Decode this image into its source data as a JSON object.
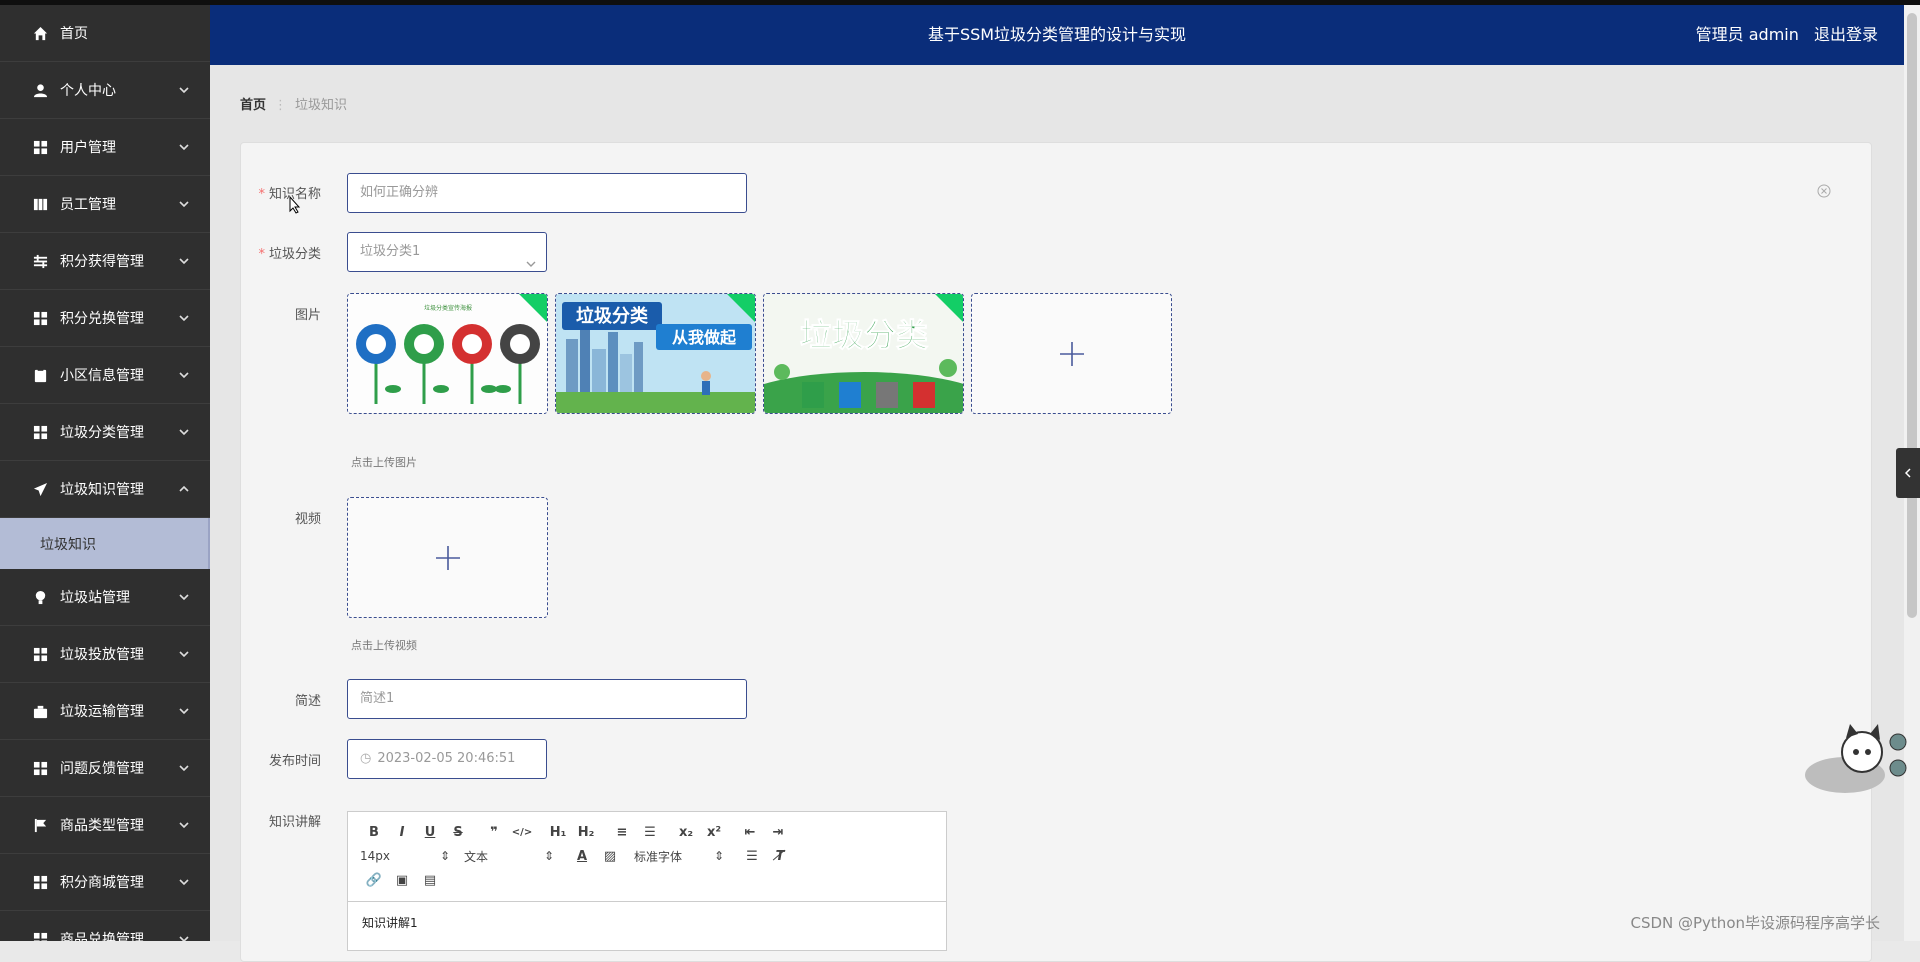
{
  "header": {
    "title": "基于SSM垃圾分类管理的设计与实现",
    "user_label": "管理员 admin",
    "logout_label": "退出登录"
  },
  "sidebar": {
    "items": [
      {
        "label": "首页",
        "icon": "home-icon"
      },
      {
        "label": "个人中心",
        "icon": "user-icon"
      },
      {
        "label": "用户管理",
        "icon": "grid-icon"
      },
      {
        "label": "员工管理",
        "icon": "book-icon"
      },
      {
        "label": "积分获得管理",
        "icon": "sliders-icon"
      },
      {
        "label": "积分兑换管理",
        "icon": "grid-icon"
      },
      {
        "label": "小区信息管理",
        "icon": "clipboard-icon"
      },
      {
        "label": "垃圾分类管理",
        "icon": "grid-icon"
      },
      {
        "label": "垃圾知识管理",
        "icon": "send-icon"
      },
      {
        "label": "垃圾站管理",
        "icon": "bulb-icon"
      },
      {
        "label": "垃圾投放管理",
        "icon": "grid-icon"
      },
      {
        "label": "垃圾运输管理",
        "icon": "briefcase-icon"
      },
      {
        "label": "问题反馈管理",
        "icon": "grid-icon"
      },
      {
        "label": "商品类型管理",
        "icon": "flag-icon"
      },
      {
        "label": "积分商城管理",
        "icon": "grid-icon"
      },
      {
        "label": "商品兑换管理",
        "icon": "grid-icon"
      }
    ],
    "active_sub": "垃圾知识"
  },
  "breadcrumb": {
    "home": "首页",
    "current": "垃圾知识"
  },
  "form": {
    "name_label": "知识名称",
    "name_value": "如何正确分辨",
    "category_label": "垃圾分类",
    "category_value": "垃圾分类1",
    "image_label": "图片",
    "image_hint": "点击上传图片",
    "images": [
      {
        "caption": "垃圾分类宣传海报"
      },
      {
        "caption": "垃圾分类 从我做起"
      },
      {
        "caption": "垃圾分类"
      }
    ],
    "video_label": "视频",
    "video_hint": "点击上传视频",
    "desc_label": "简述",
    "desc_value": "简述1",
    "time_label": "发布时间",
    "time_value": "2023-02-05 20:46:51",
    "content_label": "知识讲解",
    "content_value": "知识讲解1"
  },
  "editor": {
    "size": "14px",
    "format": "文本",
    "font": "标准字体"
  },
  "watermark": "CSDN @Python毕设源码程序高学长",
  "colors": {
    "header": "#0a2d7a",
    "sidebar": "#2f2f2f",
    "accent": "#13ce66",
    "border": "#3a4d8f"
  }
}
